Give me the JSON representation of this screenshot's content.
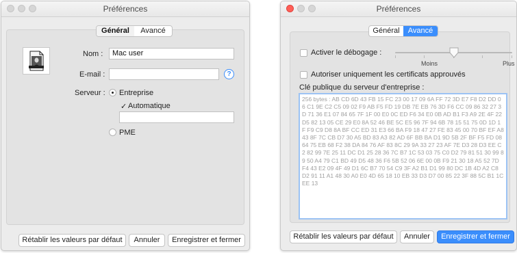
{
  "left_window": {
    "title": "Préférences",
    "tabs": [
      {
        "label": "Général",
        "selected": true
      },
      {
        "label": "Avancé",
        "selected": false
      }
    ],
    "avatar_icon": "mona-lisa-image-file-icon",
    "name_label": "Nom :",
    "name_value": "Mac user",
    "email_label": "E-mail :",
    "email_value": "",
    "help_glyph": "?",
    "server_label": "Serveur :",
    "server_options": {
      "enterprise_label": "Entreprise",
      "enterprise_selected": true,
      "automatic_label": "Automatique",
      "automatic_checked": true,
      "server_value": "",
      "pme_label": "PME",
      "pme_selected": false
    },
    "buttons": {
      "reset": "Rétablir les valeurs par défaut",
      "cancel": "Annuler",
      "save": "Enregistrer et fermer"
    }
  },
  "right_window": {
    "title": "Préférences",
    "tabs": [
      {
        "label": "Général",
        "selected": false
      },
      {
        "label": "Avancé",
        "selected": true
      }
    ],
    "debug_label": "Activer le débogage :",
    "debug_checked": false,
    "slider_min_label": "Moins",
    "slider_max_label": "Plus",
    "slider_value": 0.5,
    "certs_label": "Autoriser uniquement les certificats approuvés",
    "certs_checked": false,
    "pubkey_label": "Clé publique du serveur d'entreprise :",
    "pubkey_text": "256 bytes : AB CD 6D 43 FB 15 FC 23 00 17 09 6A FF 72 3D E7 F8 D2 DD 06 C1 9E C2 C5 09 02 F9 AB F5 FD 19 DB 7E EB 76 3D F6 CC 09 86 32 27 3D 71 36 E1 07 84 65 7F 1F 00 E0 0C ED F6 34 E0 0B AD B1 F3 A9 2E 4F 22 D5 82 13 05 CE 29 E0 8A 52 46 BE 5C E5 96 7F 94 6B 78 15 51 75 0D 1D 1F F9 C9 D8 8A BF CC ED 31 E3 66 BA F9 18 47 27 FE 83 45 00 70 BF EF A8 43 8F 7C CB D7 30 A5 BD 83 A3 82 AD 6F BB BA D1 9D 5B 2F BF F5 FD 08 64 75 EB 68 F2 38 DA 84 76 AF 83 8C 29 9A 33 27 23 AF 7E D3 28 D3 EE C2 82 99 7E 25 11 DC D1 25 28 36 7C B7 1C 53 03 75 C0 D2 79 81 51 30 99 89 50 A4 79 C1 BD 49 D5 48 36 F6 5B 52 06 6E 00 0B F9 21 30 18 A5 52 7D F4 43 E2 09 4F 49 D1 6C B7 70 54 C9 3F A2 B1 D1 99 80 DC 1B 4D A2 C8 D2 91 11 A1 48 30 A0 E0 4D 65 18 10 EB 33 D3 D7 00 85 22 3F 88 5C B1 1C EE 13",
    "buttons": {
      "reset": "Rétablir les valeurs par défaut",
      "cancel": "Annuler",
      "save": "Enregistrer et fermer"
    }
  },
  "colors": {
    "accent": "#3b8efc",
    "window_bg": "#ececec",
    "panel_bg": "#e3e3e3",
    "close_red": "#ff5f57"
  }
}
